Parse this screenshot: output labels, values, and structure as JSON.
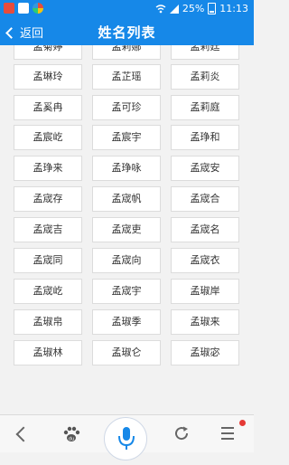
{
  "status_bar": {
    "battery_text": "25%",
    "time": "11:13"
  },
  "header": {
    "back_label": "返回",
    "title": "姓名列表"
  },
  "names": [
    [
      "孟菊婷",
      "孟莉娜",
      "孟莉廷"
    ],
    [
      "孟琳玲",
      "孟芷瑶",
      "孟莉炎"
    ],
    [
      "孟奚冉",
      "孟可珍",
      "孟莉庭"
    ],
    [
      "孟宸屹",
      "孟宸宇",
      "孟琤和"
    ],
    [
      "孟琤来",
      "孟琤咏",
      "孟宬安"
    ],
    [
      "孟宬存",
      "孟宬帆",
      "孟宬合"
    ],
    [
      "孟宬吉",
      "孟宬吏",
      "孟宬名"
    ],
    [
      "孟宬同",
      "孟宬向",
      "孟宬衣"
    ],
    [
      "孟宬屹",
      "孟宬宇",
      "孟琡岸"
    ],
    [
      "孟琡帛",
      "孟琡季",
      "孟琡来"
    ],
    [
      "孟琡林",
      "孟琡仑",
      "孟琡宓"
    ]
  ],
  "colors": {
    "accent": "#1688e8",
    "notification_dot": "#e53935"
  },
  "icons": {
    "nav_back": "chevron-left-icon",
    "home": "paw-icon",
    "voice": "microphone-icon",
    "refresh": "refresh-icon",
    "menu": "menu-icon"
  }
}
